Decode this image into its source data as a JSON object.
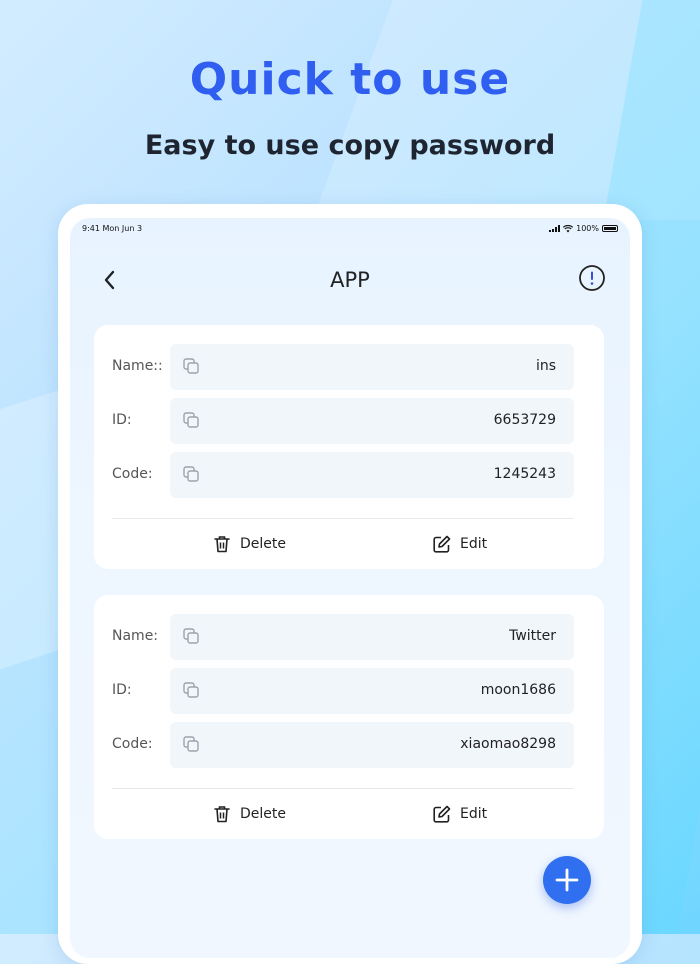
{
  "promo": {
    "headline": "Quick to use",
    "subheadline": "Easy to use copy password"
  },
  "status_bar": {
    "time": "9:41 Mon Jun 3",
    "battery": "100%"
  },
  "nav": {
    "title": "APP",
    "back_icon": "chevron-left-icon",
    "info_icon": "info-circle-icon"
  },
  "cards": [
    {
      "rows": [
        {
          "label": "Name::",
          "value": "ins"
        },
        {
          "label": "ID:",
          "value": "6653729"
        },
        {
          "label": "Code:",
          "value": "1245243"
        }
      ],
      "delete_label": "Delete",
      "edit_label": "Edit"
    },
    {
      "rows": [
        {
          "label": "Name:",
          "value": "Twitter"
        },
        {
          "label": "ID:",
          "value": "moon1686"
        },
        {
          "label": "Code:",
          "value": "xiaomao8298"
        }
      ],
      "delete_label": "Delete",
      "edit_label": "Edit"
    }
  ],
  "fab_icon": "plus-icon",
  "colors": {
    "accent": "#2f5ef0",
    "fab": "#2f6ff0",
    "text_dark": "#1e2430"
  }
}
